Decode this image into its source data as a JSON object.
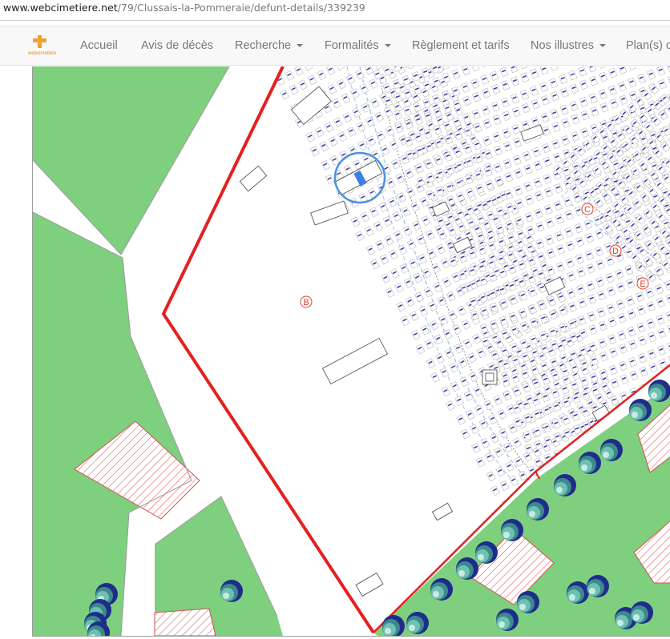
{
  "url": {
    "host": "www.webcimetiere.net",
    "path": "/79/Clussais-la-Pommeraie/defunt-details/339239"
  },
  "logo": {
    "text": "webcimetière"
  },
  "nav": [
    {
      "label": "Accueil",
      "dropdown": false
    },
    {
      "label": "Avis de décès",
      "dropdown": false
    },
    {
      "label": "Recherche",
      "dropdown": true
    },
    {
      "label": "Formalités",
      "dropdown": true
    },
    {
      "label": "Règlement et tarifs",
      "dropdown": false
    },
    {
      "label": "Nos illustres",
      "dropdown": true
    },
    {
      "label": "Plan(s) c",
      "dropdown": false
    }
  ],
  "map": {
    "sections": [
      "B",
      "C",
      "D",
      "E"
    ],
    "colors": {
      "grass": "#7ed07e",
      "boundary": "#e51f1f",
      "path": "#9fc7e6",
      "highlight": "#4a90e2",
      "grave_text": "#3a3ab0",
      "section_label": "#e0412c"
    }
  }
}
